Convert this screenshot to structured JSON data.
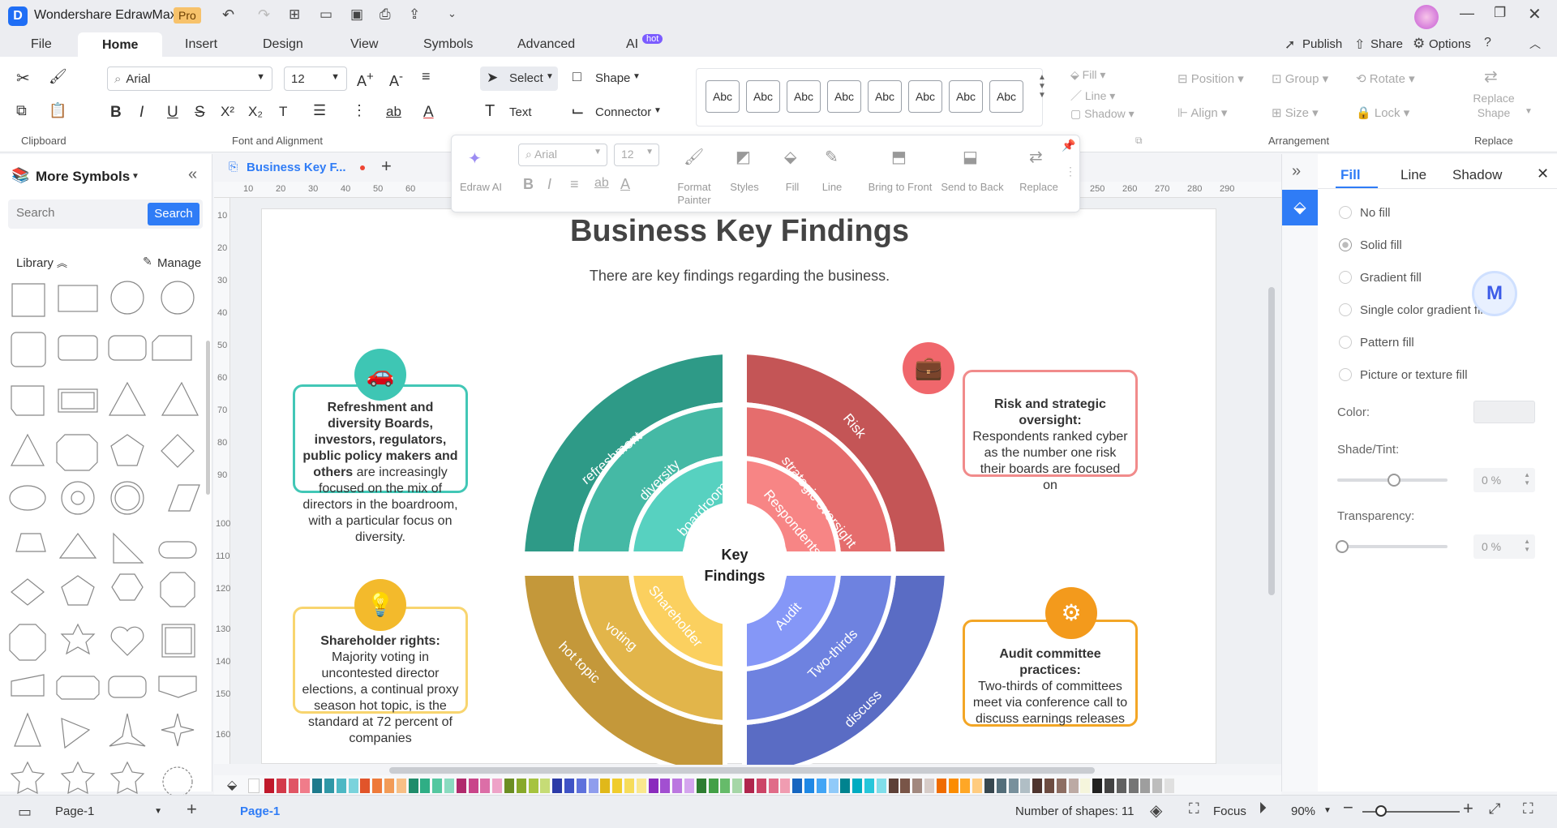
{
  "titlebar": {
    "app_name": "Wondershare EdrawMax",
    "pro_badge": "Pro"
  },
  "menubar": {
    "items": [
      "File",
      "Home",
      "Insert",
      "Design",
      "View",
      "Symbols",
      "Advanced",
      "AI"
    ],
    "active": "Home",
    "ai_badge": "hot",
    "publish": "Publish",
    "share": "Share",
    "options": "Options"
  },
  "ribbon": {
    "font_name": "Arial",
    "font_size": "12",
    "select": "Select",
    "shape": "Shape",
    "text": "Text",
    "connector": "Connector",
    "style_samples": [
      "Abc",
      "Abc",
      "Abc",
      "Abc",
      "Abc",
      "Abc",
      "Abc",
      "Abc"
    ],
    "fill": "Fill",
    "line": "Line",
    "shadow": "Shadow",
    "position": "Position",
    "group": "Group",
    "rotate": "Rotate",
    "align": "Align",
    "size": "Size",
    "lock": "Lock",
    "replace_shape": "Replace Shape",
    "groups": {
      "clipboard": "Clipboard",
      "font": "Font and Alignment",
      "arrangement": "Arrangement",
      "replace": "Replace"
    }
  },
  "floatbar": {
    "font": "Arial",
    "size": "12",
    "items": [
      "Edraw AI",
      "Format Painter",
      "Styles",
      "Fill",
      "Line",
      "Bring to Front",
      "Send to Back",
      "Replace"
    ]
  },
  "left_panel": {
    "title": "More Symbols",
    "search_placeholder": "Search",
    "search_button": "Search",
    "library": "Library",
    "manage": "Manage"
  },
  "tab": {
    "doc_name": "Business Key F..."
  },
  "ruler": {
    "h": [
      "10",
      "20",
      "30",
      "40",
      "50",
      "60",
      "250",
      "260",
      "270",
      "280",
      "290"
    ],
    "v": [
      "10",
      "20",
      "30",
      "40",
      "50",
      "60",
      "70",
      "80",
      "90",
      "100",
      "110",
      "120",
      "130",
      "140",
      "150",
      "160"
    ]
  },
  "diagram": {
    "title": "Business Key Findings",
    "subtitle": "There are key findings regarding the business.",
    "center": [
      "Key",
      "Findings"
    ],
    "labels": {
      "outer_tl": "refreshment",
      "mid_tl": "diversity",
      "inner_tl": "boardroom",
      "outer_tr": "Risk",
      "mid_tr": "strategic oversight",
      "inner_tr": "Respondents",
      "outer_bl": "hot topic",
      "mid_bl": "voting",
      "inner_bl": "Shareholder",
      "outer_br": "discuss",
      "mid_br": "Two-thirds",
      "inner_br": "Audit"
    },
    "cards": {
      "tl": {
        "bold": "Refreshment and diversity Boards, investors, regulators, public policy makers and others",
        "rest": " are increasingly focused on the mix of directors in the boardroom, with a particular focus on diversity."
      },
      "tr": {
        "bold": "Risk and strategic oversight:",
        "rest": "Respondents ranked cyber as the number one risk their boards are focused on"
      },
      "bl": {
        "bold": "Shareholder rights:",
        "rest": "Majority voting in uncontested director elections, a continual proxy season hot topic, is the standard at 72 percent of companies"
      },
      "br": {
        "bold": "Audit committee practices:",
        "rest": "Two-thirds of committees meet via conference call to discuss earnings releases"
      }
    },
    "colors": {
      "teal": "#2e9a87",
      "red": "#c45556",
      "gold": "#c4983a",
      "blue": "#5a6cc4"
    }
  },
  "right_panel": {
    "tabs": [
      "Fill",
      "Line",
      "Shadow"
    ],
    "options": [
      "No fill",
      "Solid fill",
      "Gradient fill",
      "Single color gradient fill",
      "Pattern fill",
      "Picture or texture fill"
    ],
    "color_label": "Color:",
    "shade_label": "Shade/Tint:",
    "shade_value": "0 %",
    "transparency_label": "Transparency:",
    "transparency_value": "0 %"
  },
  "statusbar": {
    "page_selector": "Page-1",
    "page_tab": "Page-1",
    "shape_count": "Number of shapes: 11",
    "focus": "Focus",
    "zoom": "90%"
  }
}
